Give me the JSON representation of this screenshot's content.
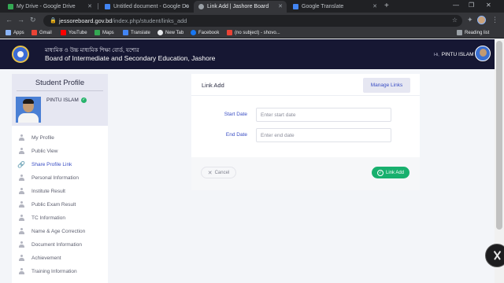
{
  "browser": {
    "tabs": [
      {
        "title": "My Drive - Google Drive",
        "favicon_color": "#34a853"
      },
      {
        "title": "Untitled document - Google Do",
        "favicon_color": "#4285f4"
      },
      {
        "title": "Link Add | Jashore Board",
        "favicon_color": "#9aa0a6"
      },
      {
        "title": "Google Translate",
        "favicon_color": "#4285f4"
      }
    ],
    "new_tab": "+",
    "url_host": "jessoreboard.gov.bd",
    "url_path": "/index.php/student/links_add",
    "bookmarks": [
      {
        "label": "Apps",
        "color": "#8ab4f8"
      },
      {
        "label": "Gmail",
        "color": "#ea4335"
      },
      {
        "label": "YouTube",
        "color": "#ff0000"
      },
      {
        "label": "Maps",
        "color": "#34a853"
      },
      {
        "label": "Translate",
        "color": "#4285f4"
      },
      {
        "label": "New Tab",
        "color": "#e8eaed"
      },
      {
        "label": "Facebook",
        "color": "#1877f2"
      },
      {
        "label": "(no subject) - shovo...",
        "color": "#ea4335"
      }
    ],
    "reading_list": "Reading list"
  },
  "header": {
    "board_name_bn": "মাধ্যমিক ও উচ্চ মাধ্যমিক শিক্ষা বোর্ড, যশোর",
    "board_name_en": "Board of Intermediate and Secondary Education, Jashore",
    "greeting": "Hi,",
    "user_name": "PINTU ISLAM"
  },
  "sidebar": {
    "title": "Student Profile",
    "name": "PINTU ISLAM",
    "items": [
      {
        "label": "My Profile",
        "icon": "person-icon"
      },
      {
        "label": "Public View",
        "icon": "person-icon"
      },
      {
        "label": "Share Profile Link",
        "icon": "link-icon"
      },
      {
        "label": "Personal Information",
        "icon": "person-icon"
      },
      {
        "label": "Institute Result",
        "icon": "person-icon"
      },
      {
        "label": "Public Exam Result",
        "icon": "person-icon"
      },
      {
        "label": "TC Information",
        "icon": "person-icon"
      },
      {
        "label": "Name & Age Correction",
        "icon": "person-icon"
      },
      {
        "label": "Document Information",
        "icon": "person-icon"
      },
      {
        "label": "Achievement",
        "icon": "person-icon"
      },
      {
        "label": "Training Information",
        "icon": "person-icon"
      }
    ],
    "active_item": "Share Profile Link"
  },
  "card": {
    "title": "Link Add",
    "manage_label": "Manage Links",
    "start_label": "Start Date",
    "start_placeholder": "Enter start date",
    "end_label": "End Date",
    "end_placeholder": "Enter end date",
    "cancel_label": "Cancel",
    "submit_label": "Link Add"
  },
  "colors": {
    "header_bg": "#161733",
    "accent": "#3a4ec4",
    "success": "#18b06e"
  }
}
